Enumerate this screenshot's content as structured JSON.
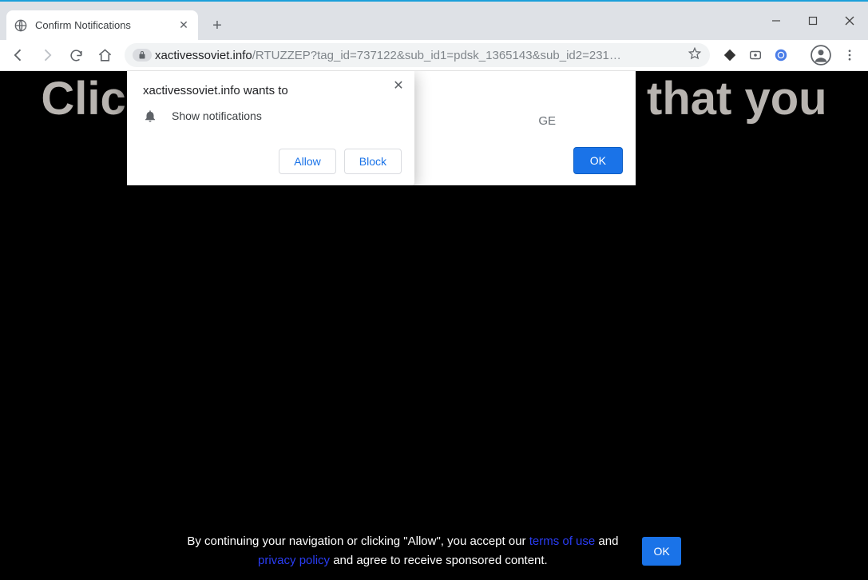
{
  "window": {
    "tab_title": "Confirm Notifications"
  },
  "omnibox": {
    "host": "xactivessoviet.info",
    "path": "/RTUZZEP?tag_id=737122&sub_id1=pdsk_1365143&sub_id2=231…"
  },
  "page": {
    "headline_left": "Clic",
    "headline_right": "that you",
    "card_fragment": "GE",
    "card_ok": "OK"
  },
  "permission": {
    "title": "xactivessoviet.info wants to",
    "item": "Show notifications",
    "allow": "Allow",
    "block": "Block"
  },
  "footer": {
    "line1a": "By continuing your navigation or clicking \"Allow\", you accept our ",
    "terms": "terms of use",
    "line1b": " and ",
    "privacy": "privacy policy",
    "line2": " and agree to receive sponsored content.",
    "ok": "OK"
  }
}
